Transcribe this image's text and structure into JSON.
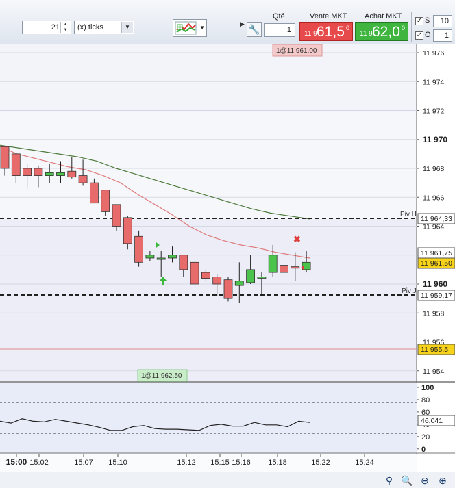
{
  "toolbar": {
    "period_value": "21",
    "period_unit": "(x) ticks",
    "indicator_button": "indicator-menu"
  },
  "trade": {
    "qty_label": "Qté",
    "qty_value": "1",
    "sell_label": "Vente MKT",
    "buy_label": "Achat MKT",
    "sell_prefix": "11 9",
    "sell_big": "61,5",
    "sell_sup": "0",
    "buy_prefix": "11 9",
    "buy_big": "62,0",
    "buy_sup": "0",
    "s_label": "S",
    "s_value": "10",
    "o_label": "O",
    "o_value": "1",
    "s_checked": "✓",
    "o_checked": "✓"
  },
  "colors": {
    "sell": "#e74a4a",
    "buy": "#3fb53f",
    "up_candle": "#4cc34c",
    "down_candle": "#e86b6b",
    "ma_fast": "#e07a7a",
    "ma_slow": "#4d7a3a"
  },
  "order_labels": {
    "sell_order": "1@11 961,00",
    "buy_order": "1@11 962,50"
  },
  "pivots": {
    "pivh_label": "Piv H",
    "pivh_value": "11 964,33",
    "pivj_label": "Piv J",
    "pivj_value": "11 959,17"
  },
  "price_tags": {
    "ask": "11 961,75",
    "last": "11 961,50",
    "level": "11 955,5"
  },
  "price_axis": [
    "11 976",
    "11 974",
    "11 972",
    "11 970",
    "11 968",
    "11 966",
    "11 964",
    "11 962",
    "11 960",
    "11 958",
    "11 956",
    "11 954"
  ],
  "osc_axis": [
    "100",
    "80",
    "60",
    "40",
    "20",
    "0"
  ],
  "osc_value": "46,041",
  "time_axis": [
    "15:00",
    "15:02",
    "15:07",
    "15:10",
    "15:12",
    "15:15",
    "15:16",
    "15:18",
    "15:22",
    "15:24"
  ],
  "chart_data": {
    "type": "candlestick",
    "ylim": [
      11953,
      11977
    ],
    "candles": [
      {
        "o": 11969.5,
        "h": 11969.5,
        "l": 11967.5,
        "c": 11968.0
      },
      {
        "o": 11969.0,
        "h": 11969.0,
        "l": 11967.0,
        "c": 11967.5
      },
      {
        "o": 11968.0,
        "h": 11968.3,
        "l": 11966.6,
        "c": 11967.5
      },
      {
        "o": 11968.0,
        "h": 11968.2,
        "l": 11966.7,
        "c": 11967.5
      },
      {
        "o": 11967.5,
        "h": 11968.3,
        "l": 11967.0,
        "c": 11967.7
      },
      {
        "o": 11967.5,
        "h": 11968.5,
        "l": 11967.0,
        "c": 11967.7
      },
      {
        "o": 11967.8,
        "h": 11968.8,
        "l": 11967.3,
        "c": 11967.4
      },
      {
        "o": 11967.5,
        "h": 11968.6,
        "l": 11966.8,
        "c": 11967.0
      },
      {
        "o": 11967.0,
        "h": 11967.3,
        "l": 11965.6,
        "c": 11965.6
      },
      {
        "o": 11966.5,
        "h": 11966.5,
        "l": 11964.7,
        "c": 11965.0
      },
      {
        "o": 11965.5,
        "h": 11965.5,
        "l": 11963.7,
        "c": 11964.0
      },
      {
        "o": 11964.6,
        "h": 11964.7,
        "l": 11962.4,
        "c": 11962.8
      },
      {
        "o": 11963.3,
        "h": 11963.7,
        "l": 11961.2,
        "c": 11961.5
      },
      {
        "o": 11961.8,
        "h": 11962.3,
        "l": 11961.6,
        "c": 11962.0
      },
      {
        "o": 11961.7,
        "h": 11962.3,
        "l": 11960.5,
        "c": 11961.8
      },
      {
        "o": 11961.8,
        "h": 11962.6,
        "l": 11961.5,
        "c": 11962.0
      },
      {
        "o": 11962.0,
        "h": 11962.0,
        "l": 11960.5,
        "c": 11961.0
      },
      {
        "o": 11961.5,
        "h": 11961.5,
        "l": 11960.0,
        "c": 11960.0
      },
      {
        "o": 11960.8,
        "h": 11961.0,
        "l": 11960.2,
        "c": 11960.4
      },
      {
        "o": 11960.5,
        "h": 11960.7,
        "l": 11959.2,
        "c": 11960.0
      },
      {
        "o": 11960.3,
        "h": 11960.5,
        "l": 11958.8,
        "c": 11959.0
      },
      {
        "o": 11959.9,
        "h": 11961.5,
        "l": 11958.7,
        "c": 11960.2
      },
      {
        "o": 11960.1,
        "h": 11962.0,
        "l": 11960.0,
        "c": 11961.0
      },
      {
        "o": 11960.5,
        "h": 11960.8,
        "l": 11959.2,
        "c": 11960.5
      },
      {
        "o": 11960.8,
        "h": 11962.7,
        "l": 11960.5,
        "c": 11962.0
      },
      {
        "o": 11961.3,
        "h": 11961.7,
        "l": 11960.1,
        "c": 11960.8
      },
      {
        "o": 11961.2,
        "h": 11962.2,
        "l": 11960.2,
        "c": 11961.1
      },
      {
        "o": 11961.0,
        "h": 11962.3,
        "l": 11960.8,
        "c": 11961.5
      }
    ],
    "ma_fast": [
      11969.5,
      11969.0,
      11968.7,
      11968.4,
      11968.1,
      11967.9,
      11967.5,
      11967.0,
      11966.2,
      11965.5,
      11964.8,
      11964.0,
      11963.4,
      11963.0,
      11962.7,
      11962.5,
      11962.2,
      11962.0,
      11961.8
    ],
    "ma_slow": [
      11969.6,
      11969.4,
      11969.2,
      11969.0,
      11968.8,
      11968.5,
      11968.0,
      11967.6,
      11967.2,
      11966.8,
      11966.4,
      11966.0,
      11965.6,
      11965.2,
      11964.9,
      11964.7,
      11964.5
    ],
    "oscillator": [
      45,
      42,
      49,
      45,
      44,
      48,
      45,
      42,
      39,
      35,
      30,
      30,
      36,
      38,
      33,
      32,
      32,
      31,
      30,
      38,
      40,
      37,
      37,
      43,
      39,
      39,
      36,
      45,
      43
    ],
    "osc_ylim": [
      0,
      100
    ]
  }
}
